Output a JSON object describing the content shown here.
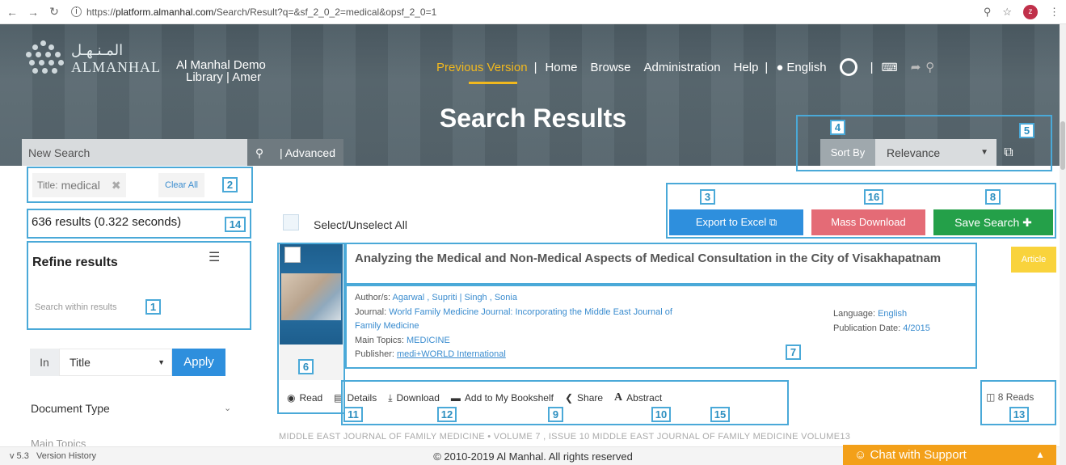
{
  "browser": {
    "url_scheme": "https://",
    "url_host": "platform.almanhal.com",
    "url_path": "/Search/Result?q=&sf_2_0_2=medical&opsf_2_0=1",
    "profile_letter": "z"
  },
  "header": {
    "logo_arabic": "المـنـهـل",
    "logo_english": "ALMANHAL",
    "library_line1": "Al Manhal Demo",
    "library_line2": "Library | Amer",
    "nav": {
      "previous_version": "Previous Version",
      "home": "Home",
      "browse": "Browse",
      "administration": "Administration",
      "help": "Help",
      "language": "English"
    },
    "page_title": "Search Results",
    "search_placeholder": "New Search",
    "advanced": "Advanced",
    "sort_label": "Sort By",
    "sort_value": "Relevance"
  },
  "filters": {
    "chip_label": "Title:",
    "chip_value": "medical",
    "clear_all": "Clear All",
    "results_count": "636 results (0.322 seconds)",
    "refine_title": "Refine results",
    "within_placeholder": "Search within results",
    "in_label": "In",
    "in_field": "Title",
    "apply": "Apply",
    "document_type": "Document Type",
    "main_topics_peek": "Main Topics"
  },
  "toolbar": {
    "select_all": "Select/Unselect All",
    "export": "Export to Excel",
    "mass_download": "Mass Download",
    "save_search": "Save Search"
  },
  "result": {
    "title": "Analyzing the Medical and Non-Medical Aspects of Medical Consultation in the City of Visakhapatnam",
    "badge": "Article",
    "authors_label": "Author/s:",
    "authors": "Agarwal , Supriti | Singh , Sonia",
    "journal_label": "Journal:",
    "journal_line1": "World Family Medicine Journal: Incorporating the Middle East Journal of",
    "journal_line2": "Family Medicine",
    "topics_label": "Main Topics:",
    "topics": "MEDICINE",
    "publisher_label": "Publisher:",
    "publisher": "medi+WORLD International",
    "language_label": "Language:",
    "language": "English",
    "pubdate_label": "Publication Date:",
    "pubdate": "4/2015",
    "actions": {
      "read": "Read",
      "details": "Details",
      "download": "Download",
      "bookshelf": "Add to My Bookshelf",
      "share": "Share",
      "abstract": "Abstract"
    },
    "reads": "8 Reads",
    "journal_strip": "MIDDLE EAST JOURNAL OF FAMILY MEDICINE • VOLUME 7 , ISSUE 10 MIDDLE EAST JOURNAL OF FAMILY MEDICINE VOLUME13"
  },
  "annotations": {
    "n1": "1",
    "n2": "2",
    "n3": "3",
    "n4": "4",
    "n5": "5",
    "n6": "6",
    "n7": "7",
    "n8": "8",
    "n9": "9",
    "n10": "10",
    "n11": "11",
    "n12": "12",
    "n13": "13",
    "n14": "14",
    "n15": "15",
    "n16": "16"
  },
  "footer": {
    "version": "v 5.3",
    "version_history": "Version History",
    "copyright": "© 2010-2019 Al Manhal. All rights reserved",
    "chat": "Chat with Support"
  },
  "colors": {
    "accent_blue": "#2e8fdd",
    "annotation_blue": "#4aa9d8",
    "nav_active": "#f1b81e",
    "mass_download": "#e46b76",
    "save_search": "#24a049",
    "chat": "#f3a019",
    "badge": "#f9d33c"
  }
}
